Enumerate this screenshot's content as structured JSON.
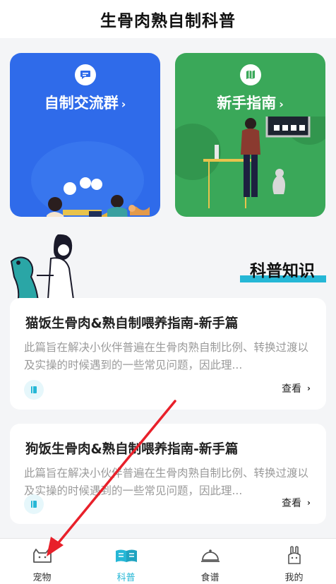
{
  "header": {
    "title": "生骨肉熟自制科普"
  },
  "cards": [
    {
      "label": "自制交流群",
      "icon": "chat-icon",
      "color": "#2f6bea"
    },
    {
      "label": "新手指南",
      "icon": "map-icon",
      "color": "#3aa859"
    }
  ],
  "section": {
    "title": "科普知识",
    "accent": "#25b7d6"
  },
  "articles": [
    {
      "title": "猫饭生骨肉&熟自制喂养指南-新手篇",
      "desc": "此篇旨在解决小伙伴普遍在生骨肉熟自制比例、转换过渡以及实操的时候遇到的一些常见问题，因此理...",
      "action": "查看"
    },
    {
      "title": "狗饭生骨肉&熟自制喂养指南-新手篇",
      "desc": "此篇旨在解决小伙伴普遍在生骨肉熟自制比例、转换过渡以及实操的时候遇到的一些常见问题，因此理...",
      "action": "查看"
    }
  ],
  "tabs": [
    {
      "label": "宠物",
      "icon": "pet-icon",
      "active": false
    },
    {
      "label": "科普",
      "icon": "book-icon",
      "active": true
    },
    {
      "label": "食谱",
      "icon": "dish-icon",
      "active": false
    },
    {
      "label": "我的",
      "icon": "rabbit-icon",
      "active": false
    }
  ],
  "colors": {
    "active_tab": "#25b7d6",
    "annotation_arrow": "#e8202a"
  }
}
